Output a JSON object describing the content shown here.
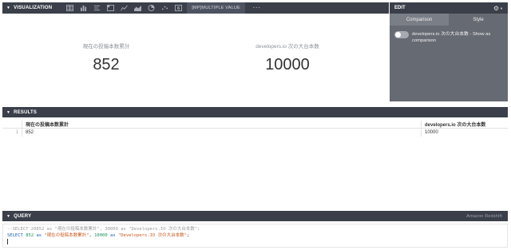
{
  "visualization": {
    "section_title": "VISUALIZATION",
    "multiple_value_label": "[MP]MULTIPLE VALUE",
    "more_label": "···",
    "numbers": [
      {
        "label": "現在の投稿本数累計",
        "value": "852"
      },
      {
        "label": "developers.io 次の大台本数",
        "value": "10000"
      }
    ]
  },
  "edit_panel": {
    "title": "EDIT",
    "tabs": [
      {
        "label": "Comparison",
        "active": true
      },
      {
        "label": "Style",
        "active": false
      }
    ],
    "toggle_label": "developers.io 次の大台本数 - Show as comparison"
  },
  "results": {
    "section_title": "RESULTS",
    "columns": [
      "現在の投稿本数累計",
      "developers.io 次の大台本数"
    ],
    "rows": [
      {
        "index": "1",
        "a": "852",
        "b": "10000"
      }
    ]
  },
  "query": {
    "section_title": "QUERY",
    "source": "Amazon Redshift",
    "comment_line": "--SELECT 20852 as \"現在の投稿本数累計\", 30000 as \"Developers.IO 次の大台本数\";",
    "code": {
      "select": "SELECT",
      "num1": "852",
      "as1": "as",
      "str1": "\"現在の投稿本数累計\"",
      "comma": ",",
      "num2": "10000",
      "as2": "as",
      "str2": "\"Developers.IO 次の大台本数\"",
      "semicolon": ";"
    }
  },
  "colors": {
    "bar_bg": "#3a3f49",
    "edit_bg": "#666b73",
    "keyword": "#1f5fb5",
    "number": "#19925a",
    "string": "#c9591d"
  }
}
